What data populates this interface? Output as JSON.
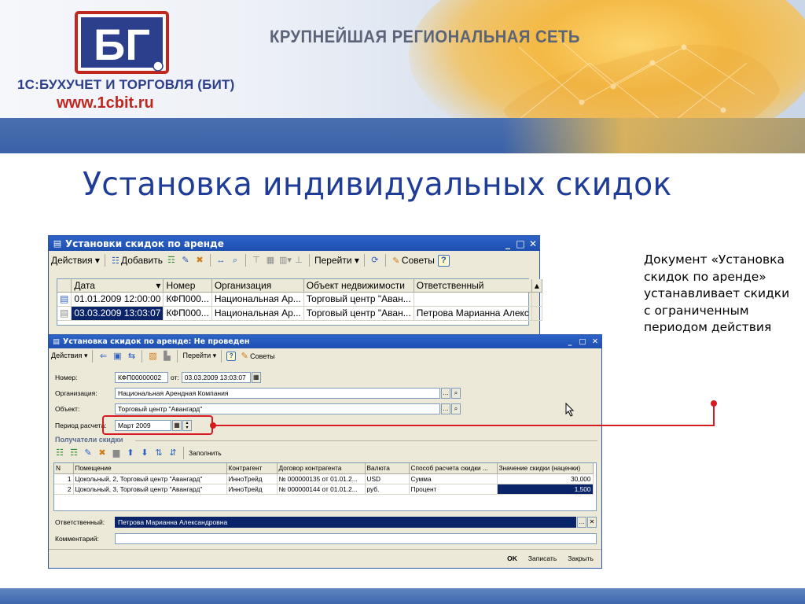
{
  "banner": {
    "logo_text": "БГ",
    "company": "1С:БУХУЧЕТ И ТОРГОВЛЯ (БИТ)",
    "site": "www.1cbit.ru",
    "tagline": "КРУПНЕЙШАЯ РЕГИОНАЛЬНАЯ СЕТЬ"
  },
  "slide_title": "Установка индивидуальных скидок",
  "list_window": {
    "title": "Установки скидок по аренде",
    "toolbar": {
      "actions": "Действия",
      "add": "Добавить",
      "goto": "Перейти",
      "tips": "Советы"
    },
    "columns": [
      "Дата",
      "Номер",
      "Организация",
      "Объект недвижимости",
      "Ответственный"
    ],
    "rows": [
      [
        "01.01.2009 12:00:00",
        "КФП000...",
        "Национальная Ар...",
        "Торговый центр \"Аван...",
        ""
      ],
      [
        "03.03.2009 13:03:07",
        "КФП000...",
        "Национальная Ар...",
        "Торговый центр \"Аван...",
        "Петрова Марианна Алекс"
      ]
    ]
  },
  "doc_window": {
    "title": "Установка скидок по аренде: Не проведен",
    "toolbar": {
      "actions": "Действия",
      "goto": "Перейти",
      "tips": "Советы"
    },
    "number_label": "Номер:",
    "number_value": "КФП00000002",
    "from_label": "от:",
    "date_value": "03.03.2009 13:03:07",
    "org_label": "Организация:",
    "org_value": "Национальная Арендная Компания",
    "object_label": "Объект:",
    "object_value": "Торговый центр \"Авангард\"",
    "period_label": "Период расчета:",
    "period_value": "Март 2009",
    "recipients_title": "Получатели скидки",
    "fill_label": "Заполнить",
    "grid_columns": [
      "N",
      "Помещение",
      "Контрагент",
      "Договор контрагента",
      "Валюта",
      "Способ расчета скидки ...",
      "Значение скидки (наценки)"
    ],
    "grid_rows": [
      [
        "1",
        "Цокольный, 2, Торговый центр \"Авангард\"",
        "ИнноТрейд",
        "№ 000000135 от 01.01.2...",
        "USD",
        "Сумма",
        "30,000"
      ],
      [
        "2",
        "Цокольный, 3, Торговый центр \"Авангард\"",
        "ИнноТрейд",
        "№ 000000144 от 01.01.2...",
        "руб.",
        "Процент",
        "1,500"
      ]
    ],
    "responsible_label": "Ответственный:",
    "responsible_value": "Петрова Марианна Александровна",
    "comment_label": "Комментарий:",
    "comment_value": "",
    "buttons": {
      "ok": "OK",
      "save": "Записать",
      "close": "Закрыть"
    }
  },
  "annotation": "Документ «Установка скидок по аренде» устанавливает скидки с ограниченным периодом действия",
  "colors": {
    "title_blue": "#1f3c97",
    "callout_red": "#d71920",
    "window_blue": "#1e4fb1"
  }
}
